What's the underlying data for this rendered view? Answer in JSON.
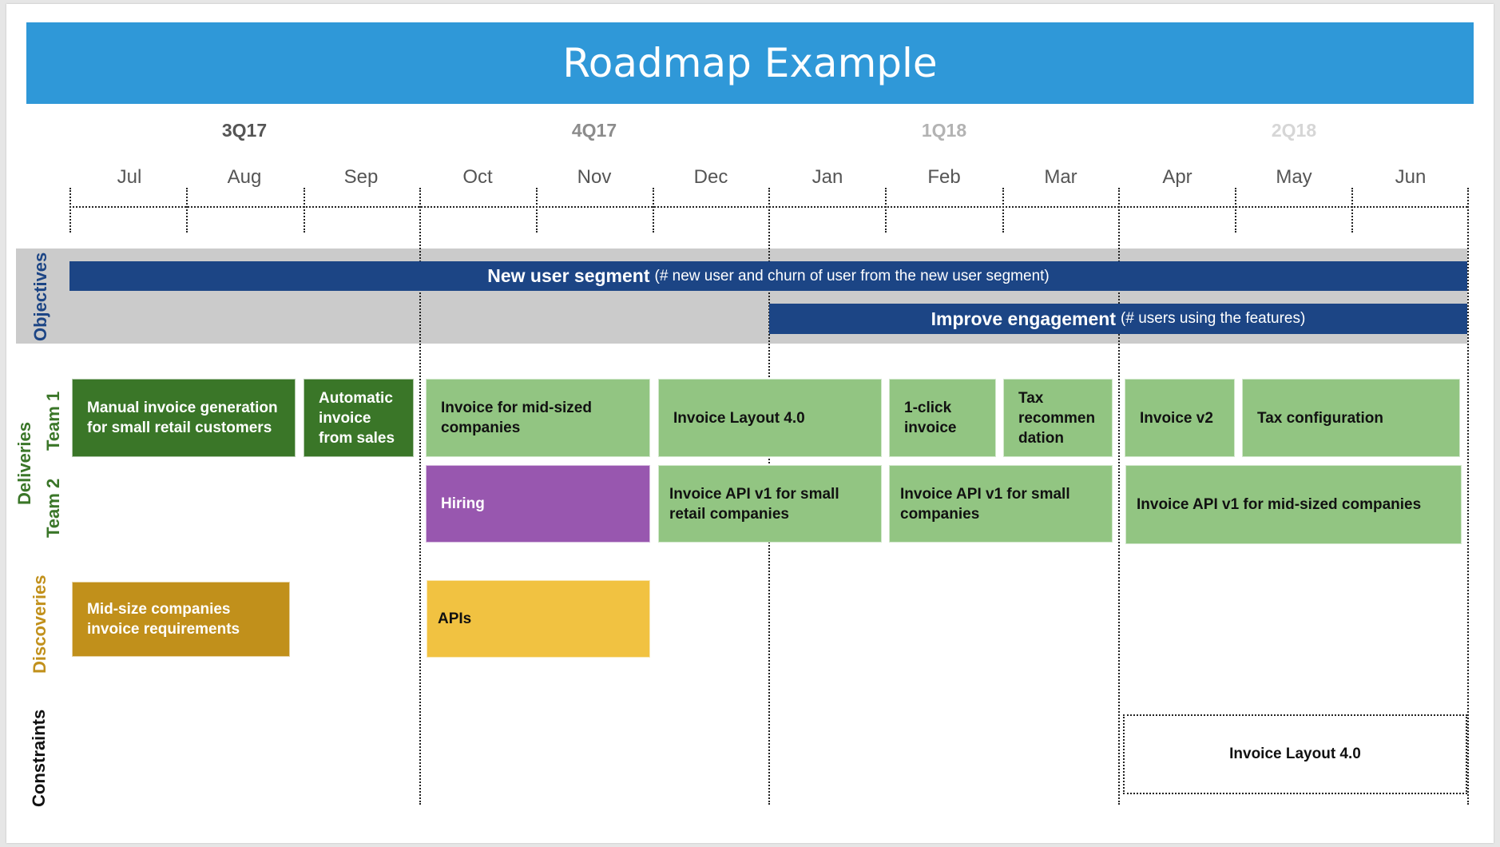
{
  "title": "Roadmap Example",
  "colors": {
    "title_bar": "#2f98d8",
    "objective_bar": "#1c4585",
    "objective_band": "#cbcbcb",
    "delivered": "#3a7628",
    "planned": "#92c582",
    "hiring": "#9857af",
    "discovery_done": "#c1901b",
    "discovery_planned": "#f1c241",
    "label_objectives": "#1c4585",
    "label_deliveries": "#3a7628",
    "label_discoveries": "#c1901b",
    "label_constraints": "#111111"
  },
  "quarters": [
    {
      "label": "3Q17",
      "color": "#555555"
    },
    {
      "label": "4Q17",
      "color": "#8c8c8c"
    },
    {
      "label": "1Q18",
      "color": "#b3b3b3"
    },
    {
      "label": "2Q18",
      "color": "#d6d6d6"
    }
  ],
  "months": [
    "Jul",
    "Aug",
    "Sep",
    "Oct",
    "Nov",
    "Dec",
    "Jan",
    "Feb",
    "Mar",
    "Apr",
    "May",
    "Jun"
  ],
  "row_labels": {
    "objectives": "Objectives",
    "deliveries": "Deliveries",
    "team1": "Team 1",
    "team2": "Team 2",
    "discoveries": "Discoveries",
    "constraints": "Constraints"
  },
  "objectives": [
    {
      "title": "New user segment",
      "metric": "(# new user and churn of user from the new user segment)",
      "start_month": "Jul",
      "end_month": "Jun"
    },
    {
      "title": "Improve engagement",
      "metric": "(# users using the features)",
      "start_month": "Jan",
      "end_month": "Jun"
    }
  ],
  "team1": [
    {
      "label": "Manual invoice generation  for small retail customers",
      "status": "delivered"
    },
    {
      "label": "Automatic invoice from sales",
      "status": "delivered"
    },
    {
      "label": "Invoice for mid-sized companies",
      "status": "planned"
    },
    {
      "label": "Invoice Layout 4.0",
      "status": "planned"
    },
    {
      "label": "1-click invoice",
      "status": "planned"
    },
    {
      "label": "Tax recommen dation",
      "status": "planned"
    },
    {
      "label": "Invoice v2",
      "status": "planned"
    },
    {
      "label": "Tax configuration",
      "status": "planned"
    }
  ],
  "team2": [
    {
      "label": "Hiring",
      "status": "hiring"
    },
    {
      "label": "Invoice API v1 for small retail companies",
      "status": "planned"
    },
    {
      "label": "Invoice API v1 for small companies",
      "status": "planned"
    },
    {
      "label": "Invoice API v1 for mid-sized companies",
      "status": "planned"
    }
  ],
  "discoveries": [
    {
      "label": "Mid-size companies invoice requirements",
      "status": "done"
    },
    {
      "label": "APIs",
      "status": "planned"
    }
  ],
  "constraints": [
    {
      "label": "Invoice Layout 4.0"
    }
  ]
}
